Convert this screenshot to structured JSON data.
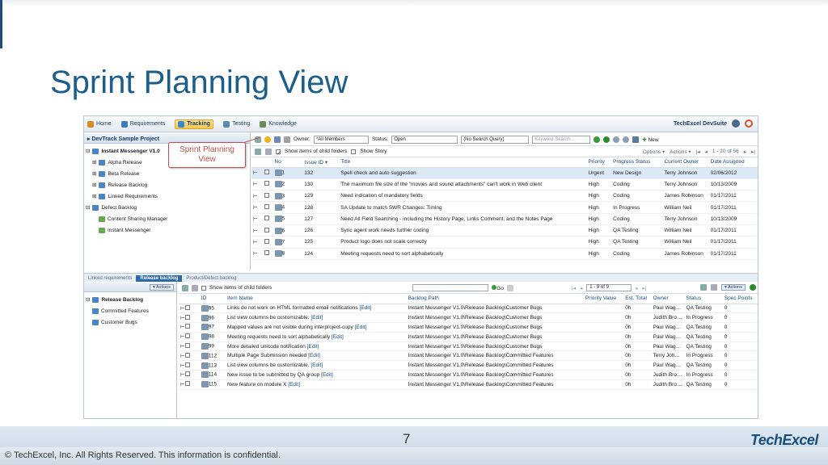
{
  "slide": {
    "title": "Sprint Planning View",
    "page_number": "7",
    "copyright": "© TechExcel, Inc. All Rights Reserved.  This information is confidential.",
    "logo": "TechExcel"
  },
  "nav": {
    "items": [
      {
        "label": "Home",
        "icon": "home-icon"
      },
      {
        "label": "Requirements",
        "icon": "requirements-icon"
      },
      {
        "label": "Tracking",
        "icon": "tracking-icon",
        "active": true
      },
      {
        "label": "Testing",
        "icon": "testing-icon"
      },
      {
        "label": "Knowledge",
        "icon": "knowledge-icon"
      }
    ],
    "brand": "TechExcel DevSuite"
  },
  "left_pane": {
    "project": "DevTrack Sample Project",
    "tree": [
      {
        "label": "Instant Messenger V1.0",
        "level": 0,
        "bold": true,
        "toggle": "⊟"
      },
      {
        "label": "Alpha Release",
        "level": 1,
        "toggle": "⊞"
      },
      {
        "label": "Beta Release",
        "level": 1,
        "toggle": "⊞"
      },
      {
        "label": "Release Backlog",
        "level": 1,
        "toggle": "⊞"
      },
      {
        "label": "Linked Requirements",
        "level": 1,
        "toggle": "⊞"
      },
      {
        "label": "Defect Backlog",
        "level": 0,
        "toggle": "⊟"
      },
      {
        "label": "Content Sharing Manager",
        "level": 2,
        "toggle": ""
      },
      {
        "label": "Instant Messenger",
        "level": 2,
        "toggle": ""
      }
    ]
  },
  "callout": {
    "line1": "Sprint Planning",
    "line2": "View"
  },
  "filters": {
    "owner_label": "Owner:",
    "owner_value": "*All Members",
    "status_label": "Status:",
    "status_value": "Open",
    "query_value": "(No Search Query)",
    "keyword_placeholder": "Keyword Search...",
    "new_label": "New"
  },
  "options_bar": {
    "show_child": "Show items of child folders",
    "show_story": "Show Story",
    "options": "Options",
    "actions": "Actions",
    "paging": "1 - 20 of 56"
  },
  "issues": {
    "columns": [
      "No",
      "Issue ID",
      "Title",
      "Priority",
      "Progress Status",
      "Current Owner",
      "Date Assigned"
    ],
    "rows": [
      {
        "no": "1",
        "id": "132",
        "title": "Spell check and auto suggestion",
        "priority": "Urgent",
        "status": "New Design",
        "owner": "Terry Johnson",
        "date": "02/06/2012"
      },
      {
        "no": "2",
        "id": "130",
        "title": "The maximum file size of the \"movies and sound attachments\" can't work in Web client",
        "priority": "High",
        "status": "Coding",
        "owner": "Terry Johnson",
        "date": "10/13/2009"
      },
      {
        "no": "3",
        "id": "129",
        "title": "Need indication of mandatory fields",
        "priority": "High",
        "status": "Coding",
        "owner": "James Robinson",
        "date": "01/17/2011"
      },
      {
        "no": "4",
        "id": "128",
        "title": "SA Update to match SWR Changes: Timing",
        "priority": "High",
        "status": "In Progress",
        "owner": "William Neil",
        "date": "01/17/2011"
      },
      {
        "no": "5",
        "id": "127",
        "title": "Need All Field Searching - including the History Page, Links Comment, and the Notes Page",
        "priority": "High",
        "status": "Coding",
        "owner": "Terry Johnson",
        "date": "10/13/2009"
      },
      {
        "no": "6",
        "id": "126",
        "title": "Sync agent work needs further coding",
        "priority": "High",
        "status": "QA Testing",
        "owner": "William Neil",
        "date": "01/17/2011"
      },
      {
        "no": "7",
        "id": "125",
        "title": "Product logo does not scale correctly",
        "priority": "High",
        "status": "QA Testing",
        "owner": "William Neil",
        "date": "01/17/2011"
      },
      {
        "no": "8",
        "id": "124",
        "title": "Meeting requests need to sort alphabetically",
        "priority": "High",
        "status": "Coding",
        "owner": "James Robinson",
        "date": "01/17/2011"
      }
    ]
  },
  "tabs": [
    {
      "label": "Linked requirements"
    },
    {
      "label": "Release backlog",
      "active": true
    },
    {
      "label": "Product/Defect backlog"
    }
  ],
  "backlog_left": {
    "actions": "Actions",
    "tree": [
      {
        "label": "Release Backlog",
        "level": 0,
        "bold": true,
        "toggle": "⊟"
      },
      {
        "label": "Committed Features",
        "level": 1,
        "toggle": ""
      },
      {
        "label": "Customer Bugs",
        "level": 1,
        "toggle": ""
      }
    ]
  },
  "backlog": {
    "show_child": "Show items of child folders",
    "go": "Go",
    "paging": "1 - 9 of 9",
    "actions": "Actions",
    "columns": [
      "ID",
      "Item Name",
      "Backlog Path",
      "Priority Value",
      "Est. Total",
      "Owner",
      "Status",
      "Spec Points"
    ],
    "rows": [
      {
        "id": "95",
        "name": "Links do not work on HTML formatted email notifications",
        "edit": "[Edit]",
        "path": "Instant Messenger V1.0\\Release Backlog\\Customer Bugs",
        "priority": "",
        "est": "0h",
        "owner": "Paul Wagner",
        "status": "QA Testing",
        "points": "0"
      },
      {
        "id": "96",
        "name": "List view columns be customizable.",
        "edit": "[Edit]",
        "path": "Instant Messenger V1.0\\Release Backlog\\Customer Bugs",
        "priority": "",
        "est": "0h",
        "owner": "Judith Brown",
        "status": "In Progress",
        "points": "0"
      },
      {
        "id": "97",
        "name": "Mapped values are not visible during interproject-copy",
        "edit": "[Edit]",
        "path": "Instant Messenger V1.0\\Release Backlog\\Customer Bugs",
        "priority": "",
        "est": "0h",
        "owner": "Paul Wagner",
        "status": "QA Testing",
        "points": "0"
      },
      {
        "id": "98",
        "name": "Meeting requests need to sort alphabetically",
        "edit": "[Edit]",
        "path": "Instant Messenger V1.0\\Release Backlog\\Customer Bugs",
        "priority": "",
        "est": "0h",
        "owner": "Paul Wagner",
        "status": "QA Testing",
        "points": "0"
      },
      {
        "id": "99",
        "name": "More detailed unicode notification",
        "edit": "[Edit]",
        "path": "Instant Messenger V1.0\\Release Backlog\\Customer Bugs",
        "priority": "",
        "est": "0h",
        "owner": "Paul Wagner",
        "status": "QA Testing",
        "points": "0"
      },
      {
        "id": "112",
        "name": "Multiple Page Submission needed",
        "edit": "[Edit]",
        "path": "Instant Messenger V1.0\\Release Backlog\\Committed Features",
        "priority": "",
        "est": "0h",
        "owner": "Terry Johnson",
        "status": "In Progress",
        "points": "0"
      },
      {
        "id": "113",
        "name": "List view columns be customizable.",
        "edit": "[Edit]",
        "path": "Instant Messenger V1.0\\Release Backlog\\Committed Features",
        "priority": "",
        "est": "0h",
        "owner": "Paul Wagner",
        "status": "QA Testing",
        "points": "0"
      },
      {
        "id": "114",
        "name": "New issue to be submitted by QA group",
        "edit": "[Edit]",
        "path": "Instant Messenger V1.0\\Release Backlog\\Committed Features",
        "priority": "",
        "est": "0h",
        "owner": "Judith Brown",
        "status": "In Progress",
        "points": "0"
      },
      {
        "id": "115",
        "name": "New feature on module X",
        "edit": "[Edit]",
        "path": "Instant Messenger V1.0\\Release Backlog\\Committed Features",
        "priority": "",
        "est": "0h",
        "owner": "Judith Brown",
        "status": "QA Testing",
        "points": "0"
      }
    ]
  },
  "colors": {
    "title": "#1b5e8c",
    "accent": "#2e6aa6",
    "callout": "#c0504d",
    "active_tab": "#f7c750"
  }
}
